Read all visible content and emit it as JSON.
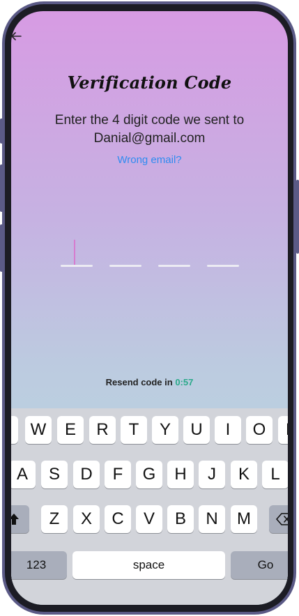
{
  "screen": {
    "title": "Verification Code",
    "subtitle_line1": "Enter the 4 digit code we sent to",
    "subtitle_line2": "Danial@gmail.com",
    "wrong_email_link": "Wrong email?",
    "resend_label": "Resend code in",
    "resend_timer": "0:57",
    "otp_slots": 4
  },
  "keyboard": {
    "row1": [
      "Q",
      "W",
      "E",
      "R",
      "T",
      "Y",
      "U",
      "I",
      "O",
      "P"
    ],
    "row2": [
      "A",
      "S",
      "D",
      "F",
      "G",
      "H",
      "J",
      "K",
      "L"
    ],
    "row3": [
      "Z",
      "X",
      "C",
      "V",
      "B",
      "N",
      "M"
    ],
    "numbers_key": "123",
    "space_key": "space",
    "go_key": "Go"
  },
  "colors": {
    "gradient_top": "#d79be3",
    "gradient_bottom": "#b7dede",
    "link": "#2e8bf0",
    "timer": "#2aa98a"
  }
}
